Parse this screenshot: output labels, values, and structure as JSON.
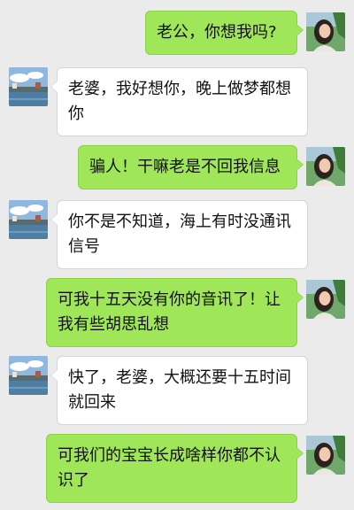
{
  "chat": {
    "messages": [
      {
        "sender": "wife",
        "text": "老公，你想我吗?"
      },
      {
        "sender": "husband",
        "text": "老婆，我好想你，晚上做梦都想你"
      },
      {
        "sender": "wife",
        "text": "骗人！干嘛老是不回我信息"
      },
      {
        "sender": "husband",
        "text": "你不是不知道，海上有时没通讯信号"
      },
      {
        "sender": "wife",
        "text": "可我十五天没有你的音讯了！让我有些胡思乱想"
      },
      {
        "sender": "husband",
        "text": "快了，老婆，大概还要十五时间就回来"
      },
      {
        "sender": "wife",
        "text": "可我们的宝宝长成啥样你都不认识了"
      }
    ]
  },
  "colors": {
    "background": "#ebebeb",
    "outgoing_bubble": "#9fe658",
    "incoming_bubble": "#ffffff"
  },
  "icons": {
    "wife_avatar": "woman-photo-avatar",
    "husband_avatar": "seaside-photo-avatar"
  }
}
